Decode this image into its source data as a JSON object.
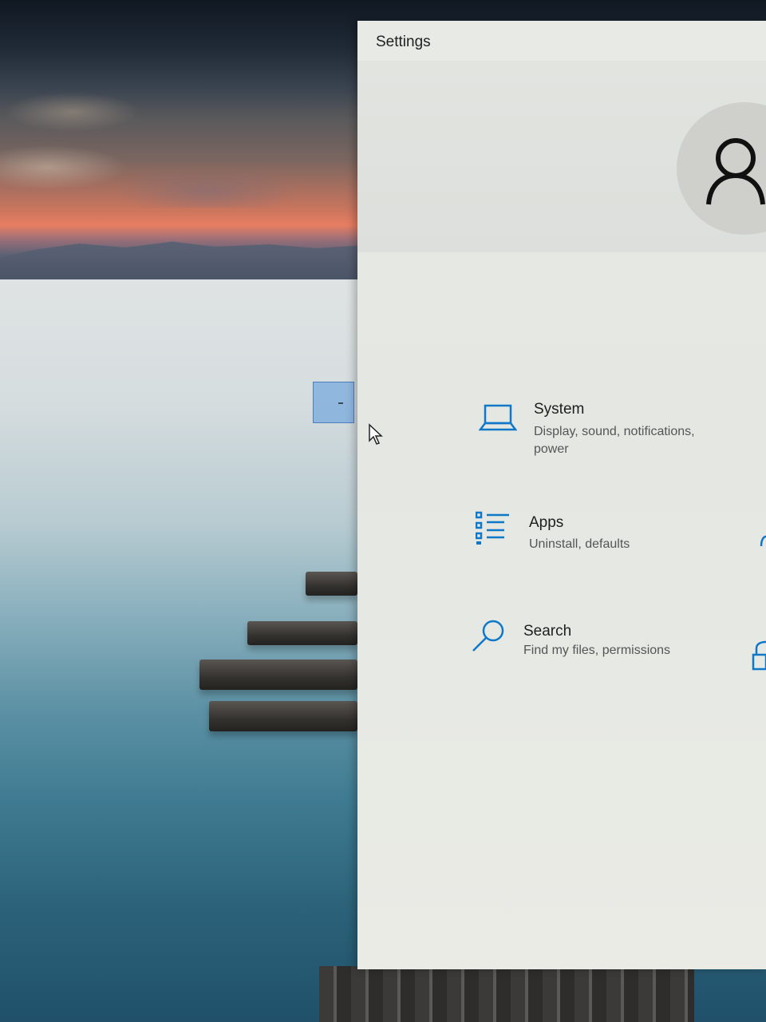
{
  "window": {
    "title": "Settings"
  },
  "tiles": [
    {
      "name": "System",
      "description": "Display, sound, notifications, power",
      "icon": "laptop-icon"
    },
    {
      "name": "Apps",
      "description": "Uninstall, defaults",
      "icon": "apps-list-icon"
    },
    {
      "name": "Search",
      "description": "Find my files, permissions",
      "icon": "search-icon"
    }
  ],
  "colors": {
    "accent": "#0f78c8",
    "window_bg": "#e8eae6",
    "avatar_bg": "#cfd0cc"
  }
}
